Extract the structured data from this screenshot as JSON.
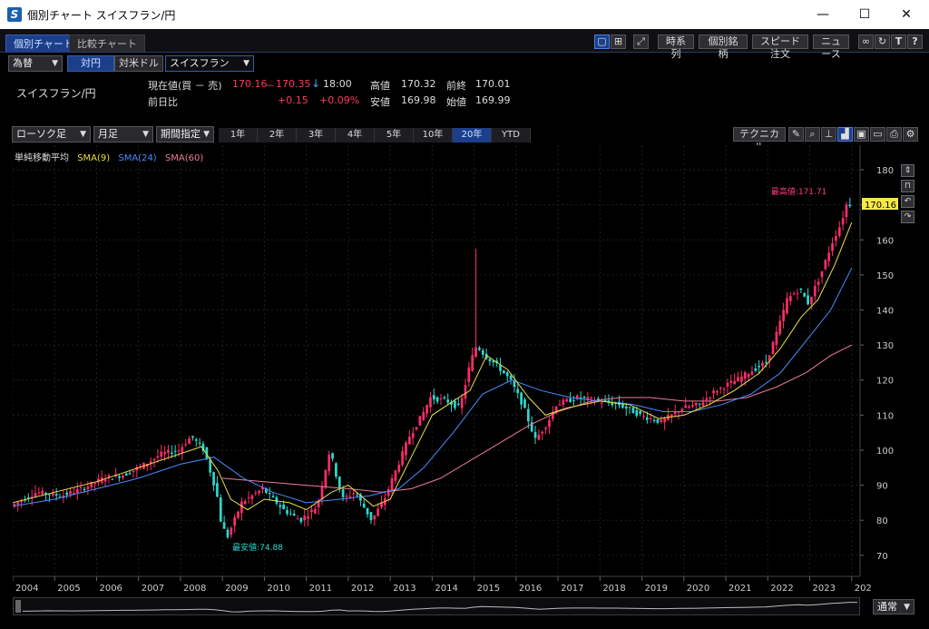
{
  "window": {
    "title": "個別チャート スイスフラン/円",
    "icon": "app-logo-icon",
    "controls": [
      "minimize-icon",
      "maximize-icon",
      "close-icon"
    ]
  },
  "tabs": [
    {
      "label": "個別チャート",
      "active": true
    },
    {
      "label": "比較チャート",
      "active": false
    }
  ],
  "toolbar": {
    "layout_icons": [
      "single-layout-icon",
      "grid-layout-icon"
    ],
    "draw_icon": "draw-line-icon",
    "buttons": [
      "時系列",
      "個別銘柄",
      "スピード注文",
      "ニュース"
    ],
    "right_icons": [
      "link-icon",
      "refresh-icon",
      "text-icon",
      "help-icon"
    ]
  },
  "selector": {
    "market": "為替",
    "quote_tabs": [
      {
        "label": "対円",
        "active": true
      },
      {
        "label": "対米ドル",
        "active": false
      }
    ],
    "symbol": "スイスフラン"
  },
  "quote": {
    "pair": "スイスフラン/円",
    "current_label": "現在値(買 － 売)",
    "bid": "170.16",
    "dash": "－",
    "ask": "170.35",
    "arrow": "↓",
    "time": "18:00",
    "prev_label": "前日比",
    "change": "+0.15",
    "change_pct": "+0.09%",
    "high_label": "高値",
    "high": "170.32",
    "low_label": "安値",
    "low": "169.98",
    "close_label": "前終",
    "close": "170.01",
    "open_label": "始値",
    "open": "169.99"
  },
  "chart_controls": {
    "candle_type": "ローソク足",
    "interval": "月足",
    "range_mode": "期間指定",
    "periods": [
      {
        "label": "1年",
        "active": false
      },
      {
        "label": "2年",
        "active": false
      },
      {
        "label": "3年",
        "active": false
      },
      {
        "label": "4年",
        "active": false
      },
      {
        "label": "5年",
        "active": false
      },
      {
        "label": "10年",
        "active": false
      },
      {
        "label": "20年",
        "active": true
      },
      {
        "label": "YTD",
        "active": false
      }
    ],
    "technical_label": "テクニカル",
    "tool_icons": [
      "pencil-icon",
      "zoom-icon",
      "crosshair-icon",
      "chart-style-icon",
      "save-icon",
      "folder-icon",
      "print-icon",
      "settings-icon"
    ]
  },
  "indicators": {
    "title": "単純移動平均",
    "sma9": "SMA(9)",
    "sma24": "SMA(24)",
    "sma60": "SMA(60)",
    "colors": {
      "sma9": "#e8e04a",
      "sma24": "#4a8cff",
      "sma60": "#f07a9a"
    }
  },
  "right_panel_icons": [
    "collapse-icon",
    "lock-icon",
    "undo-icon",
    "redo-icon"
  ],
  "annotations": {
    "high_label": "最高値:171.71",
    "low_label": "最安値:74.88",
    "last_price": "170.16"
  },
  "footer": {
    "scale_mode": "通常"
  },
  "chart_data": {
    "type": "candlestick",
    "title": "",
    "x": [
      "2004",
      "2005",
      "2006",
      "2007",
      "2008",
      "2009",
      "2010",
      "2011",
      "2012",
      "2013",
      "2014",
      "2015",
      "2016",
      "2017",
      "2018",
      "2019",
      "2020",
      "2021",
      "2022",
      "2023",
      "202"
    ],
    "y_ticks": [
      70,
      80,
      90,
      100,
      110,
      120,
      130,
      140,
      150,
      160,
      170,
      180
    ],
    "ylim": [
      64,
      187
    ],
    "grid": true,
    "series": [
      {
        "name": "SMA(9)",
        "color": "#e8e04a"
      },
      {
        "name": "SMA(24)",
        "color": "#4a8cff"
      },
      {
        "name": "SMA(60)",
        "color": "#f07a9a"
      }
    ],
    "price_path": [
      [
        2004.0,
        84
      ],
      [
        2004.6,
        88
      ],
      [
        2005.2,
        87
      ],
      [
        2005.7,
        89
      ],
      [
        2006.2,
        92
      ],
      [
        2006.7,
        93
      ],
      [
        2007.2,
        96
      ],
      [
        2007.6,
        99
      ],
      [
        2008.0,
        100
      ],
      [
        2008.3,
        104
      ],
      [
        2008.6,
        100
      ],
      [
        2008.9,
        88
      ],
      [
        2009.0,
        80
      ],
      [
        2009.15,
        75
      ],
      [
        2009.5,
        85
      ],
      [
        2010.0,
        89
      ],
      [
        2010.5,
        83
      ],
      [
        2010.9,
        80
      ],
      [
        2011.3,
        84
      ],
      [
        2011.6,
        100
      ],
      [
        2011.9,
        86
      ],
      [
        2012.2,
        88
      ],
      [
        2012.6,
        80
      ],
      [
        2012.9,
        86
      ],
      [
        2013.1,
        92
      ],
      [
        2013.5,
        104
      ],
      [
        2013.8,
        110
      ],
      [
        2014.0,
        115
      ],
      [
        2014.4,
        114
      ],
      [
        2014.7,
        112
      ],
      [
        2014.95,
        125
      ],
      [
        2015.1,
        130
      ],
      [
        2015.3,
        127
      ],
      [
        2015.6,
        124
      ],
      [
        2015.9,
        120
      ],
      [
        2016.2,
        113
      ],
      [
        2016.5,
        103
      ],
      [
        2016.8,
        108
      ],
      [
        2017.0,
        113
      ],
      [
        2017.5,
        115
      ],
      [
        2018.0,
        114
      ],
      [
        2018.5,
        113
      ],
      [
        2019.0,
        110
      ],
      [
        2019.5,
        108
      ],
      [
        2020.0,
        112
      ],
      [
        2020.4,
        113
      ],
      [
        2020.8,
        117
      ],
      [
        2021.3,
        120
      ],
      [
        2021.7,
        123
      ],
      [
        2022.0,
        125
      ],
      [
        2022.3,
        135
      ],
      [
        2022.5,
        143
      ],
      [
        2022.8,
        146
      ],
      [
        2023.0,
        142
      ],
      [
        2023.3,
        150
      ],
      [
        2023.6,
        160
      ],
      [
        2023.8,
        165
      ],
      [
        2023.9,
        170
      ],
      [
        2024.0,
        170.16
      ]
    ],
    "sma9_path": [
      [
        2004.0,
        85
      ],
      [
        2005.0,
        88
      ],
      [
        2006.0,
        91
      ],
      [
        2007.0,
        95
      ],
      [
        2008.0,
        99
      ],
      [
        2008.5,
        101
      ],
      [
        2008.9,
        94
      ],
      [
        2009.2,
        86
      ],
      [
        2009.6,
        83
      ],
      [
        2010.0,
        86
      ],
      [
        2010.6,
        85
      ],
      [
        2011.0,
        83
      ],
      [
        2011.6,
        88
      ],
      [
        2012.0,
        90
      ],
      [
        2012.6,
        84
      ],
      [
        2013.0,
        86
      ],
      [
        2013.5,
        98
      ],
      [
        2014.0,
        110
      ],
      [
        2014.5,
        114
      ],
      [
        2014.9,
        117
      ],
      [
        2015.3,
        127
      ],
      [
        2015.8,
        123
      ],
      [
        2016.3,
        115
      ],
      [
        2016.7,
        110
      ],
      [
        2017.2,
        112
      ],
      [
        2018.0,
        114
      ],
      [
        2018.7,
        113
      ],
      [
        2019.4,
        109
      ],
      [
        2020.0,
        110
      ],
      [
        2020.6,
        113
      ],
      [
        2021.2,
        117
      ],
      [
        2021.8,
        122
      ],
      [
        2022.3,
        129
      ],
      [
        2022.8,
        138
      ],
      [
        2023.2,
        143
      ],
      [
        2023.6,
        153
      ],
      [
        2024.0,
        165
      ]
    ],
    "sma24_path": [
      [
        2004.0,
        84
      ],
      [
        2005.0,
        86
      ],
      [
        2006.0,
        89
      ],
      [
        2007.0,
        92
      ],
      [
        2008.0,
        96
      ],
      [
        2008.8,
        98
      ],
      [
        2009.5,
        92
      ],
      [
        2010.2,
        88
      ],
      [
        2011.0,
        85
      ],
      [
        2011.8,
        86
      ],
      [
        2012.5,
        87
      ],
      [
        2013.2,
        89
      ],
      [
        2013.8,
        95
      ],
      [
        2014.5,
        105
      ],
      [
        2015.2,
        116
      ],
      [
        2015.9,
        120
      ],
      [
        2016.6,
        117
      ],
      [
        2017.3,
        115
      ],
      [
        2018.0,
        114
      ],
      [
        2018.8,
        113
      ],
      [
        2019.5,
        111
      ],
      [
        2020.2,
        111
      ],
      [
        2020.9,
        113
      ],
      [
        2021.6,
        116
      ],
      [
        2022.3,
        122
      ],
      [
        2022.9,
        131
      ],
      [
        2023.5,
        140
      ],
      [
        2024.0,
        152
      ]
    ],
    "sma60_path": [
      [
        2009.0,
        92
      ],
      [
        2010.0,
        91
      ],
      [
        2011.0,
        90
      ],
      [
        2012.0,
        89
      ],
      [
        2012.8,
        88
      ],
      [
        2013.5,
        89
      ],
      [
        2014.2,
        92
      ],
      [
        2014.9,
        97
      ],
      [
        2015.6,
        102
      ],
      [
        2016.3,
        107
      ],
      [
        2017.0,
        111
      ],
      [
        2017.8,
        114
      ],
      [
        2018.5,
        115
      ],
      [
        2019.2,
        115
      ],
      [
        2020.0,
        114
      ],
      [
        2020.8,
        114
      ],
      [
        2021.5,
        115
      ],
      [
        2022.2,
        118
      ],
      [
        2022.9,
        122
      ],
      [
        2023.5,
        127
      ],
      [
        2024.0,
        130
      ]
    ],
    "spike": {
      "x": 2015.05,
      "high": 157.5,
      "low": 124
    },
    "all_time_high": 171.71,
    "all_time_low": 74.88
  }
}
